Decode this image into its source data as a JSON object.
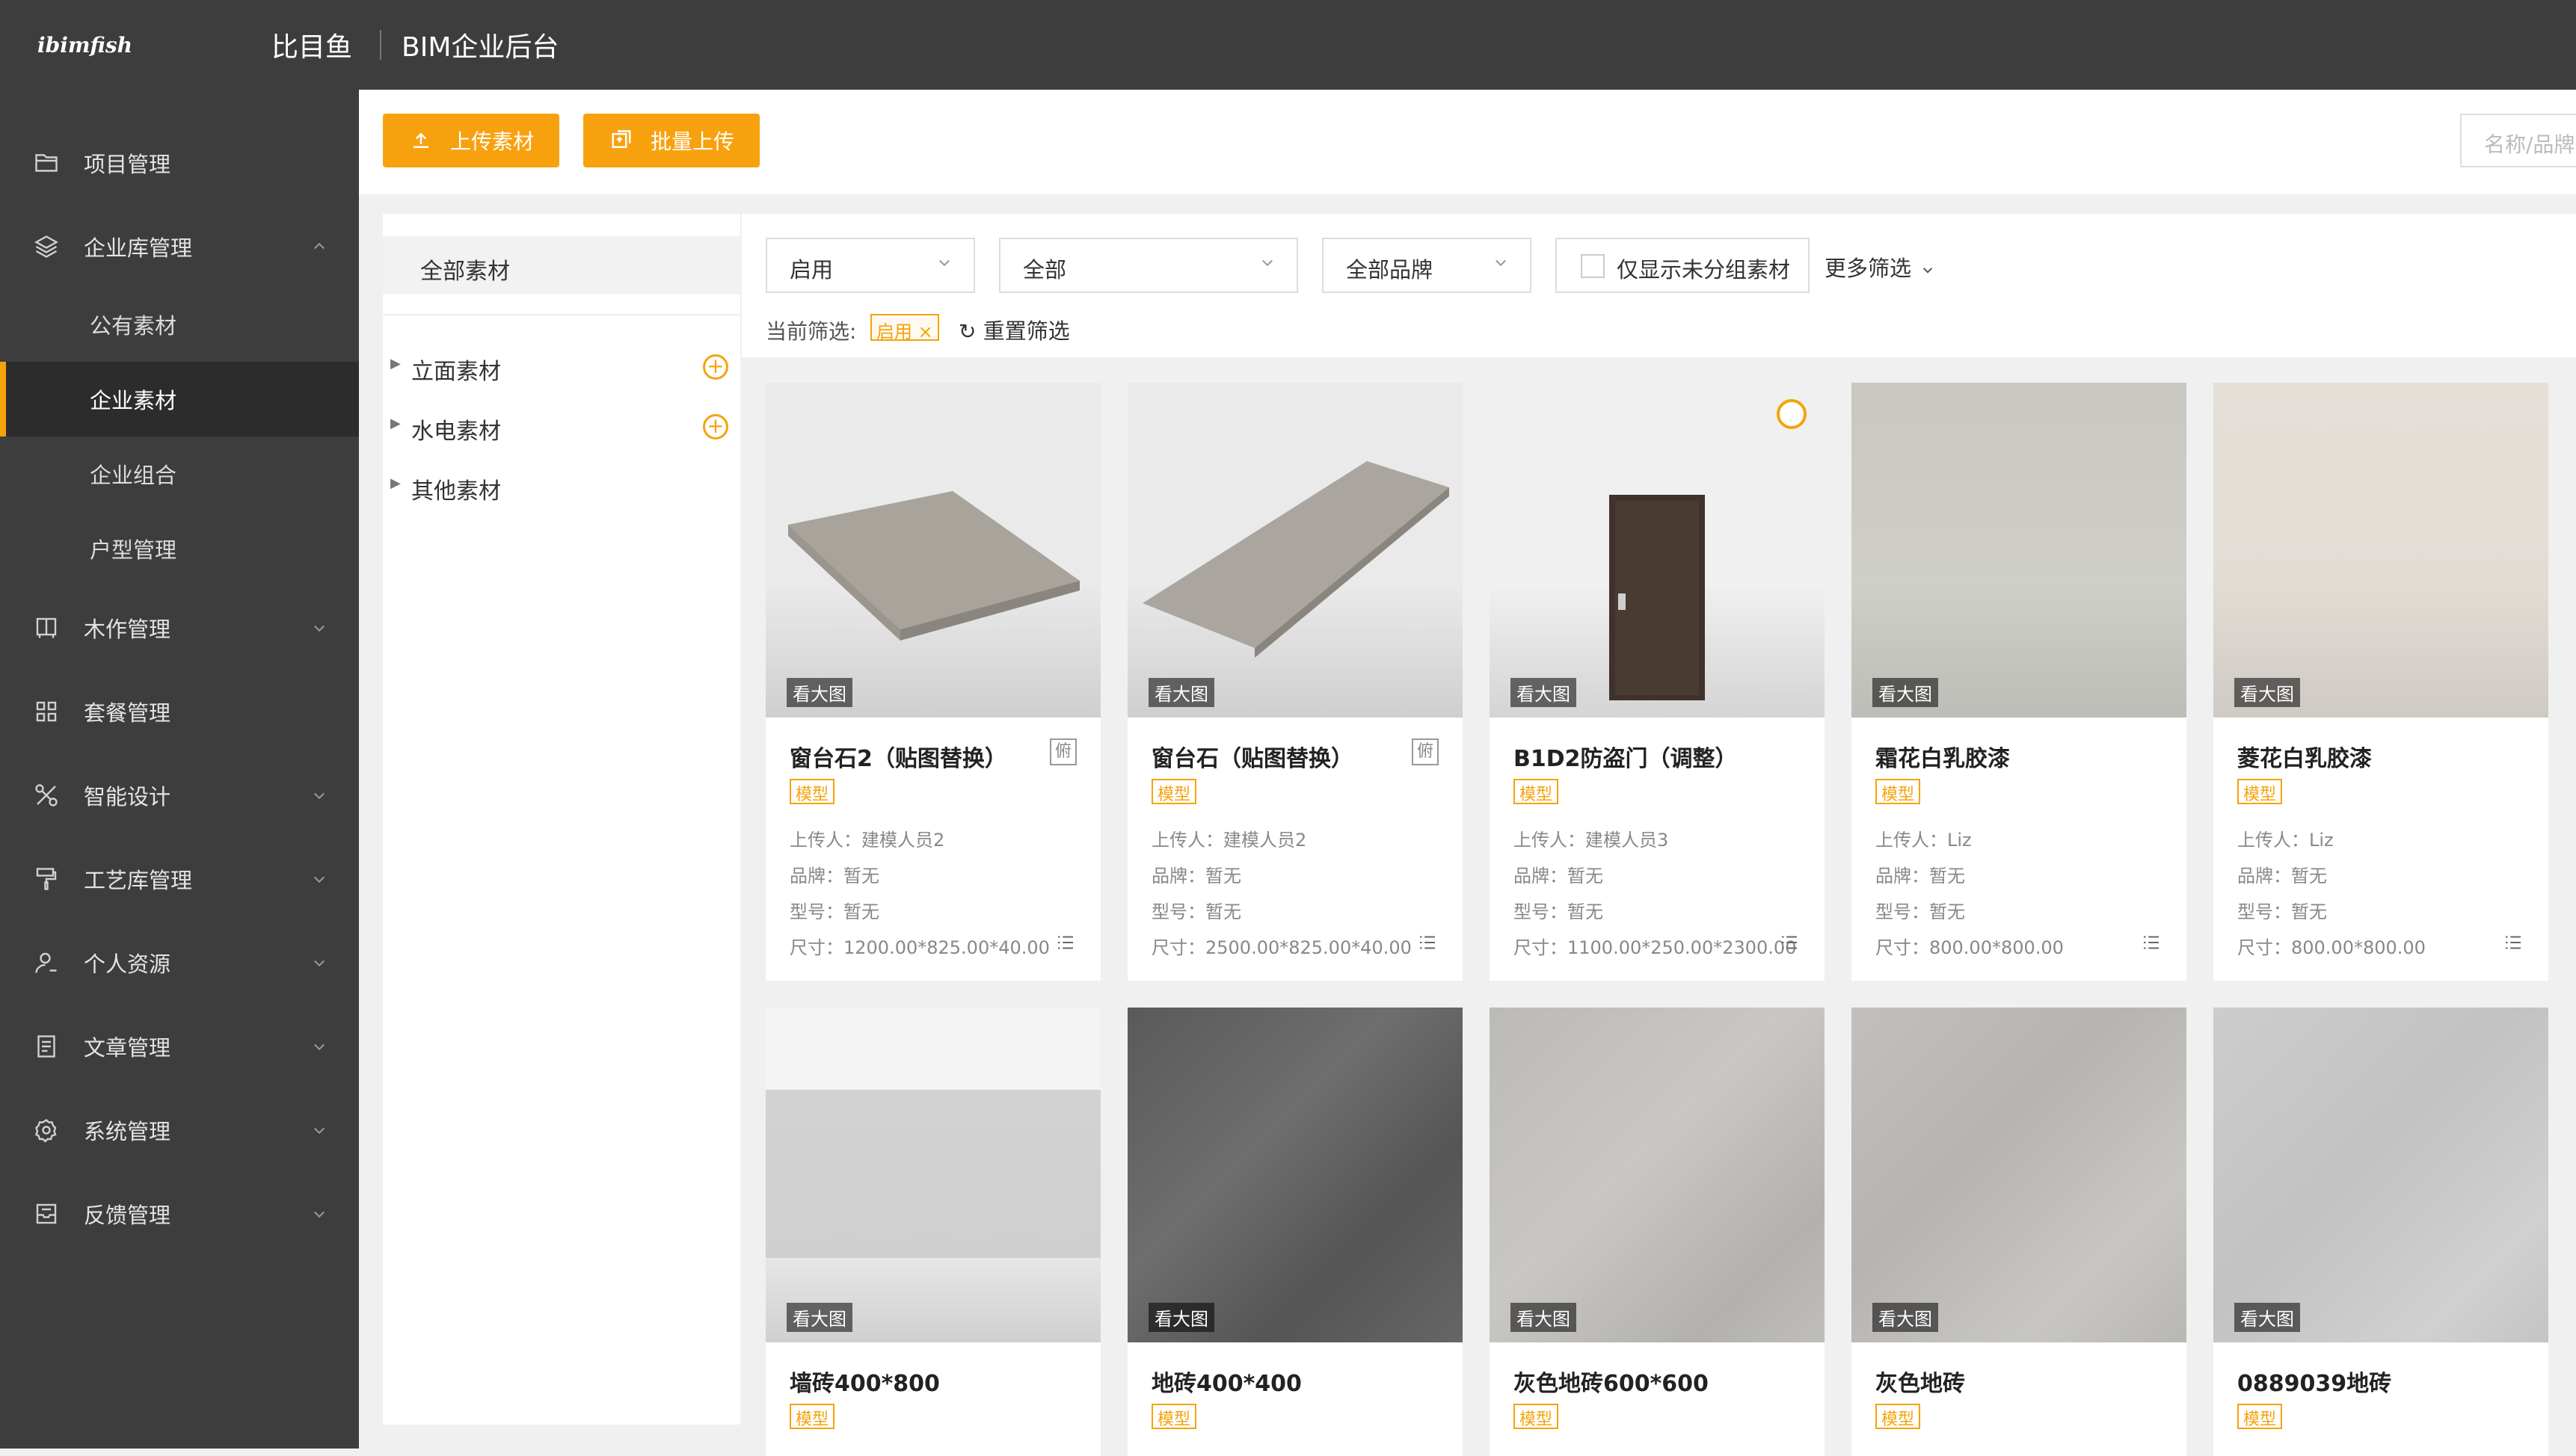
{
  "header": {
    "logo": "ibimfish",
    "brand": "比目鱼",
    "app_title": "BIM企业后台"
  },
  "sidebar": {
    "items": [
      {
        "label": "项目管理",
        "icon": "folder-icon"
      },
      {
        "label": "企业库管理",
        "icon": "layers-icon"
      },
      {
        "label": "木作管理",
        "icon": "cabinet-icon"
      },
      {
        "label": "套餐管理",
        "icon": "grid-icon"
      },
      {
        "label": "智能设计",
        "icon": "design-icon"
      },
      {
        "label": "工艺库管理",
        "icon": "paint-roller-icon"
      },
      {
        "label": "个人资源",
        "icon": "user-icon"
      },
      {
        "label": "文章管理",
        "icon": "document-icon"
      },
      {
        "label": "系统管理",
        "icon": "gear-icon"
      },
      {
        "label": "反馈管理",
        "icon": "inbox-icon"
      }
    ],
    "subitems": [
      "公有素材",
      "企业素材",
      "企业组合",
      "户型管理"
    ]
  },
  "toolbar": {
    "upload_label": "上传素材",
    "batch_label": "批量上传",
    "search_placeholder": "名称/品牌"
  },
  "tree": {
    "all_label": "全部素材",
    "items": [
      "立面素材",
      "水电素材",
      "其他素材"
    ]
  },
  "filters": {
    "status": "启用",
    "category": "全部",
    "brand": "全部品牌",
    "ungrouped_label": "仅显示未分组素材",
    "more_label": "更多筛选",
    "current_label": "当前筛选:",
    "current_tag": "启用",
    "reset_label": "重置筛选"
  },
  "labels": {
    "view_large": "看大图",
    "type_tag": "模型",
    "view_badge": "俯"
  },
  "cards": [
    {
      "name": "窗台石2（贴图替换）",
      "uploader": "上传人：建模人员2",
      "brand": "品牌：暂无",
      "model": "型号：暂无",
      "size": "尺寸：1200.00*825.00*40.00"
    },
    {
      "name": "窗台石（贴图替换）",
      "uploader": "上传人：建模人员2",
      "brand": "品牌：暂无",
      "model": "型号：暂无",
      "size": "尺寸：2500.00*825.00*40.00"
    },
    {
      "name": "B1D2防盗门（调整）",
      "uploader": "上传人：建模人员3",
      "brand": "品牌：暂无",
      "model": "型号：暂无",
      "size": "尺寸：1100.00*250.00*2300.00"
    },
    {
      "name": "霜花白乳胶漆",
      "uploader": "上传人：Liz",
      "brand": "品牌：暂无",
      "model": "型号：暂无",
      "size": "尺寸：800.00*800.00"
    },
    {
      "name": "菱花白乳胶漆",
      "uploader": "上传人：Liz",
      "brand": "品牌：暂无",
      "model": "型号：暂无",
      "size": "尺寸：800.00*800.00"
    },
    {
      "name": "墙砖400*800"
    },
    {
      "name": "地砖400*400"
    },
    {
      "name": "灰色地砖600*600"
    },
    {
      "name": "灰色地砖"
    },
    {
      "name": "0889039地砖"
    }
  ]
}
